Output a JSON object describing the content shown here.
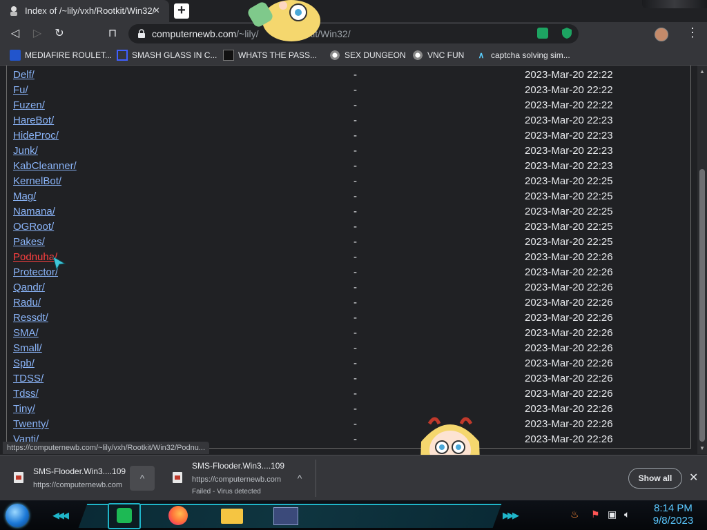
{
  "tab": {
    "title": "Index of /~lily/vxh/Rootkit/Win32/",
    "close": "×",
    "new_tab": "+"
  },
  "toolbar": {
    "back": "◁",
    "forward": "▷",
    "reload": "↻",
    "bookmark": "⊓",
    "url_host": "computernewb.com",
    "url_path_visible_1": "/~lily/",
    "url_path_visible_2": "otkit/Win32/",
    "menu": "⋮"
  },
  "bookmarks": [
    {
      "label": "MEDIAFIRE ROULET...",
      "icon": "mediafire-icon"
    },
    {
      "label": "SMASH GLASS IN C...",
      "icon": "sigma-icon"
    },
    {
      "label": "WHATS THE PASS...",
      "icon": "dark-square-icon"
    },
    {
      "label": "SEX DUNGEON",
      "icon": "gear-icon"
    },
    {
      "label": "VNC FUN",
      "icon": "gear-icon"
    },
    {
      "label": "captcha solving sim...",
      "icon": "arrow-a-icon"
    }
  ],
  "listing": [
    {
      "name": "Delf/",
      "size": "-",
      "date": "2023-Mar-20 22:22"
    },
    {
      "name": "Fu/",
      "size": "-",
      "date": "2023-Mar-20 22:22"
    },
    {
      "name": "Fuzen/",
      "size": "-",
      "date": "2023-Mar-20 22:22"
    },
    {
      "name": "HareBot/",
      "size": "-",
      "date": "2023-Mar-20 22:23"
    },
    {
      "name": "HideProc/",
      "size": "-",
      "date": "2023-Mar-20 22:23"
    },
    {
      "name": "Junk/",
      "size": "-",
      "date": "2023-Mar-20 22:23"
    },
    {
      "name": "KabCleanner/",
      "size": "-",
      "date": "2023-Mar-20 22:23"
    },
    {
      "name": "KernelBot/",
      "size": "-",
      "date": "2023-Mar-20 22:25"
    },
    {
      "name": "Mag/",
      "size": "-",
      "date": "2023-Mar-20 22:25"
    },
    {
      "name": "Namana/",
      "size": "-",
      "date": "2023-Mar-20 22:25"
    },
    {
      "name": "OGRoot/",
      "size": "-",
      "date": "2023-Mar-20 22:25"
    },
    {
      "name": "Pakes/",
      "size": "-",
      "date": "2023-Mar-20 22:25"
    },
    {
      "name": "Podnuha/",
      "size": "-",
      "date": "2023-Mar-20 22:26",
      "visited": true
    },
    {
      "name": "Protector/",
      "size": "-",
      "date": "2023-Mar-20 22:26"
    },
    {
      "name": "Qandr/",
      "size": "-",
      "date": "2023-Mar-20 22:26"
    },
    {
      "name": "Radu/",
      "size": "-",
      "date": "2023-Mar-20 22:26"
    },
    {
      "name": "Ressdt/",
      "size": "-",
      "date": "2023-Mar-20 22:26"
    },
    {
      "name": "SMA/",
      "size": "-",
      "date": "2023-Mar-20 22:26"
    },
    {
      "name": "Small/",
      "size": "-",
      "date": "2023-Mar-20 22:26"
    },
    {
      "name": "Spb/",
      "size": "-",
      "date": "2023-Mar-20 22:26"
    },
    {
      "name": "TDSS/",
      "size": "-",
      "date": "2023-Mar-20 22:26"
    },
    {
      "name": "Tdss/",
      "size": "-",
      "date": "2023-Mar-20 22:26"
    },
    {
      "name": "Tiny/",
      "size": "-",
      "date": "2023-Mar-20 22:26"
    },
    {
      "name": "Twenty/",
      "size": "-",
      "date": "2023-Mar-20 22:26"
    },
    {
      "name": "Vanti/",
      "size": "-",
      "date": "2023-Mar-20 22:26"
    }
  ],
  "status_url": "https://computernewb.com/~lily/vxh/Rootkit/Win32/Podnu...",
  "downloads": [
    {
      "name": "SMS-Flooder.Win3....109",
      "sub": "https://computernewb.com",
      "sub2": ""
    },
    {
      "name": "SMS-Flooder.Win3....109",
      "sub": "https://computernewb.com",
      "sub2": "Failed - Virus detected"
    }
  ],
  "shelf": {
    "show_all": "Show all",
    "close": "✕",
    "chevron": "^"
  },
  "taskbar": {
    "time": "8:14 PM",
    "date": "9/8/2023"
  },
  "colors": {
    "link": "#8ab4f8",
    "visited": "#ff4040",
    "accent": "#1fb5c9"
  }
}
